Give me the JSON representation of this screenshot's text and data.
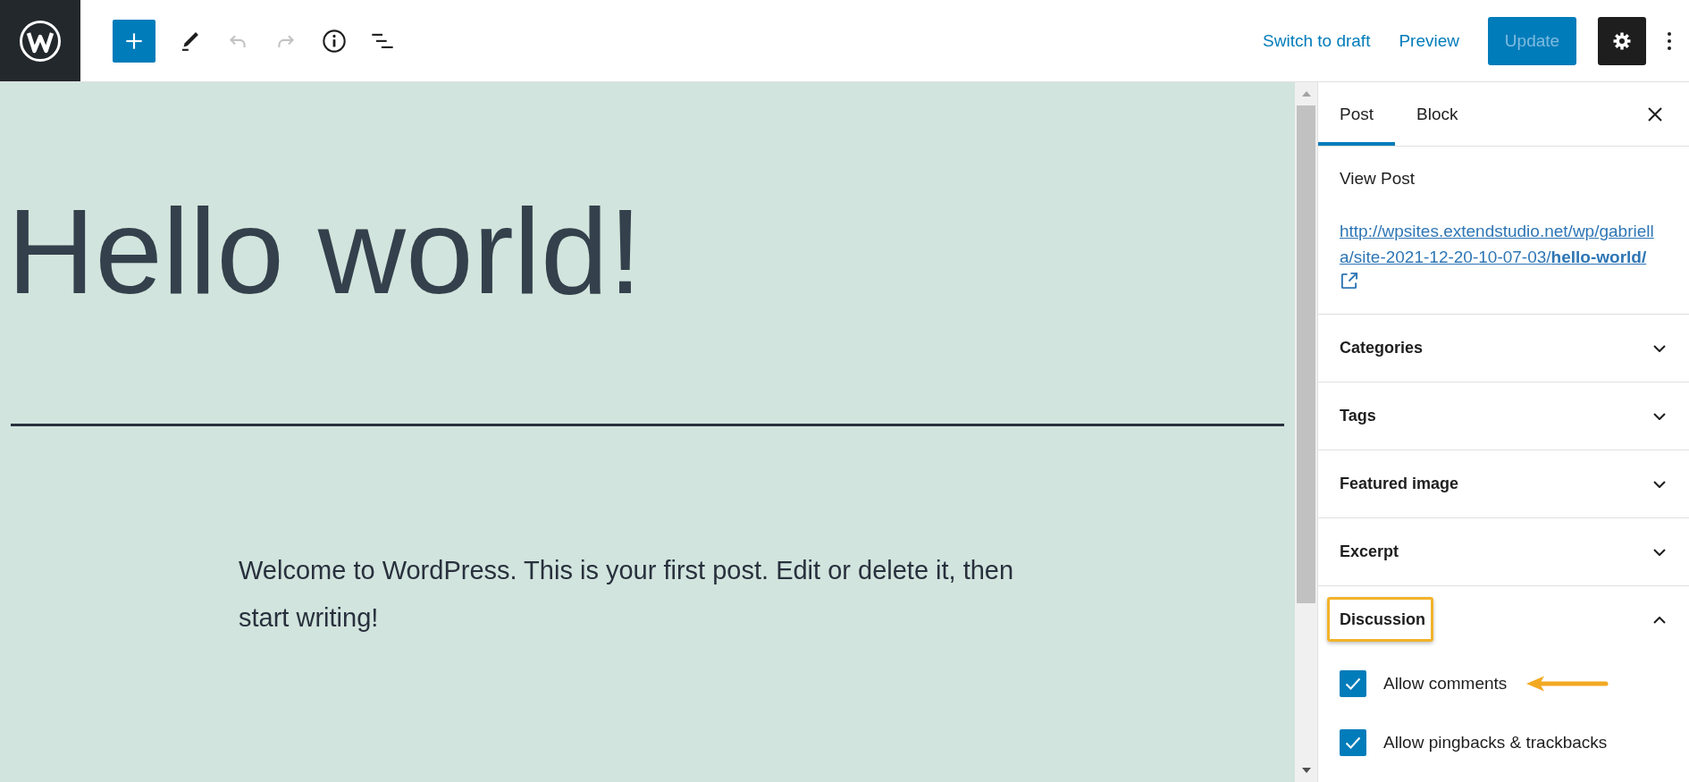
{
  "toolbar": [
    {
      "kind": "add",
      "disabled": false
    },
    {
      "kind": "tools",
      "disabled": false
    },
    {
      "kind": "undo",
      "disabled": true
    },
    {
      "kind": "redo",
      "disabled": true
    },
    {
      "kind": "info",
      "disabled": false
    },
    {
      "kind": "outline",
      "disabled": false
    }
  ],
  "actions": [
    {
      "kind": "link",
      "label": "Switch to draft",
      "disabled": false
    },
    {
      "kind": "link",
      "label": "Preview",
      "disabled": false
    },
    {
      "kind": "primary",
      "label": "Update",
      "disabled": true
    }
  ],
  "settings": {
    "pressed": true
  },
  "editor": {
    "title": "Hello world!",
    "paragraph": "Welcome to WordPress. This is your first post. Edit or delete it, then start writing!"
  },
  "sidebar": {
    "tabs": [
      {
        "label": "Post",
        "selected": true
      },
      {
        "label": "Block",
        "selected": false
      }
    ],
    "view_post": {
      "label": "View Post",
      "url": "http://wpsites.extendstudio.net/wp/gabriella/site-2021-12-20-10-07-03/**hello-world/**"
    },
    "panels": [
      {
        "title": "Categories",
        "expanded": false,
        "highlighted": false
      },
      {
        "title": "Tags",
        "expanded": false,
        "highlighted": false
      },
      {
        "title": "Featured image",
        "expanded": false,
        "highlighted": false
      },
      {
        "title": "Excerpt",
        "expanded": false,
        "highlighted": false
      },
      {
        "title": "Discussion",
        "expanded": true,
        "highlighted": true,
        "options": [
          {
            "label": "Allow comments",
            "checked": true,
            "arrow": true
          },
          {
            "label": "Allow pingbacks & trackbacks",
            "checked": true,
            "arrow": false
          }
        ]
      }
    ]
  }
}
